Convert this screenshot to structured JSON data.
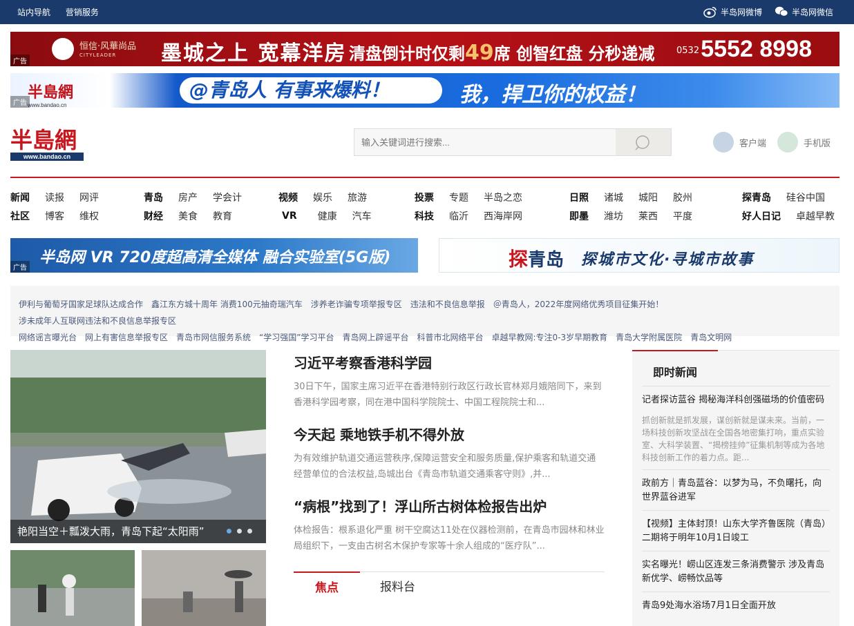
{
  "topbar": {
    "nav": "站内导航",
    "marketing": "营销服务",
    "weibo": "半岛网微博",
    "wechat": "半岛网微信"
  },
  "ads": {
    "tag": "广告",
    "ad1": {
      "brand": "恒信·风華尚品",
      "brand_sub": "CITYLEADER",
      "slogan": "墨城之上 宽幕洋房",
      "mid_a": "清盘倒计时仅剩",
      "mid_num": "49",
      "mid_b": "席 创智红盘 分秒递减",
      "area": "0532",
      "phone": "5552 8998"
    },
    "ad2": {
      "logo": "半島網",
      "url": "www.bandao.cn",
      "pill": "@青岛人 有事来爆料！",
      "right": "我，捍卫你的权益！"
    },
    "ad3": {
      "text": "半岛网 VR 720度超高清全媒体 融合实验室(5G版)"
    },
    "ad4": {
      "t1a": "探",
      "t1b": "青岛",
      "t2": "探城市文化·寻城市故事"
    }
  },
  "site": {
    "logo": "半島網",
    "url": "www.bandao.cn"
  },
  "search": {
    "placeholder": "输入关键词进行搜索..."
  },
  "clients": {
    "app": "客户端",
    "mobile": "手机版"
  },
  "nav": [
    {
      "row1": [
        "新闻",
        "读报",
        "网评"
      ],
      "row2": [
        "社区",
        "博客",
        "维权"
      ]
    },
    {
      "row1": [
        "青岛",
        "房产",
        "学会计"
      ],
      "row2": [
        "财经",
        "美食",
        "教育"
      ]
    },
    {
      "row1": [
        "视频",
        "娱乐",
        "旅游"
      ],
      "row2": [
        "VR",
        "健康",
        "汽车"
      ]
    },
    {
      "row1": [
        "投票",
        "专题",
        "半岛之恋"
      ],
      "row2": [
        "科技",
        "临沂",
        "西海岸网"
      ]
    },
    {
      "row1": [
        "日照",
        "诸城",
        "城阳",
        "胶州"
      ],
      "row2": [
        "即墨",
        "潍坊",
        "莱西",
        "平度"
      ]
    },
    {
      "row1": [
        "探青岛",
        "硅谷中国"
      ],
      "row2": [
        "好人日记",
        "卓越早教"
      ]
    }
  ],
  "links": [
    "伊利与葡萄牙国家足球队达成合作",
    "鑫江东方城十周年 消费100元抽奇瑞汽车",
    "涉养老诈骗专项举报专区",
    "违法和不良信息举报",
    "＠青岛人，2022年度网络优秀项目征集开始！",
    "涉未成年人互联网违法和不良信息举报专区",
    "网络谣言曝光台",
    "网上有害信息举报专区",
    "青岛市网信服务系统",
    "“学习强国”学习平台",
    "青岛网上辟谣平台",
    "科普市北网络平台",
    "卓越早教网:专注0-3岁早期教育",
    "青岛大学附属医院",
    "青岛文明网"
  ],
  "slide": {
    "caption": "艳阳当空＋瓢泼大雨，青岛下起“太阳雨”"
  },
  "headlines": [
    {
      "title": "习近平考察香港科学园",
      "summary": "30日下午，国家主席习近平在香港特别行政区行政长官林郑月娥陪同下，来到香港科学园考察，同在港中国科学院院士、中国工程院院士和..."
    },
    {
      "title": "今天起 乘地铁手机不得外放",
      "summary": "为有效维护轨道交通运营秩序,保障运营安全和服务质量,保护乘客和轨道交通经营单位的合法权益,岛城出台《青岛市轨道交通乘客守则》,并..."
    },
    {
      "title": "“病根”找到了！浮山所古树体检报告出炉",
      "summary": "体检报告：根系退化严重 树干空腐达11处在仪器检测前，在青岛市园林和林业局组织下，一支由古树名木保护专家等十余人组成的“医疗队”..."
    }
  ],
  "tabs": [
    "焦点",
    "报料台"
  ],
  "side": {
    "title": "即时新闻",
    "items": [
      {
        "title": "记者探访蓝谷 揭秘海洋科创强磁场的价值密码",
        "desc": "抓创新就是抓发展，谋创新就是谋未来。当前，一场科技创新攻坚战在全国各地密集打响，重点实验室、大科学装置、“揭榜挂帅”征集机制等成为各地科技创新工作的着力点。距..."
      },
      {
        "title": "政前方｜青岛蓝谷：以梦为马，不负曙托，向世界蓝谷进军",
        "desc": ""
      },
      {
        "title": "【视频】主体封顶！山东大学齐鲁医院（青岛）二期将于明年10月1日竣工",
        "desc": ""
      },
      {
        "title": "实名曝光！崂山区连发三条消费警示 涉及青岛新优学、崂畅饮品等",
        "desc": ""
      },
      {
        "title": "青岛9处海水浴场7月1日全面开放",
        "desc": ""
      }
    ]
  }
}
